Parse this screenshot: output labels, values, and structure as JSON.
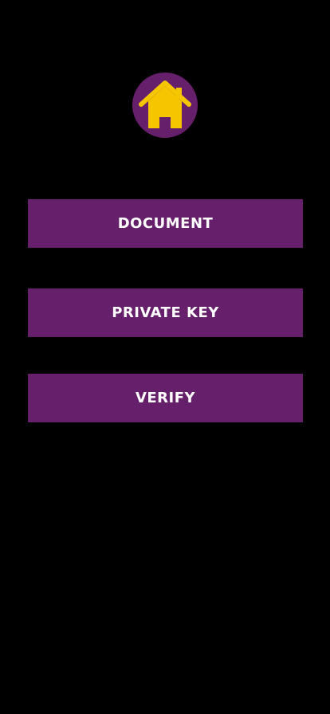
{
  "header": {
    "logo_icon": "home-icon",
    "logo_background_color": "#661f6a",
    "logo_icon_color": "#f5c500"
  },
  "menu": {
    "button_color": "#661f6a",
    "text_color": "#ffffff",
    "items": [
      {
        "label": "DOCUMENT"
      },
      {
        "label": "PRIVATE KEY"
      },
      {
        "label": "VERIFY"
      }
    ]
  }
}
